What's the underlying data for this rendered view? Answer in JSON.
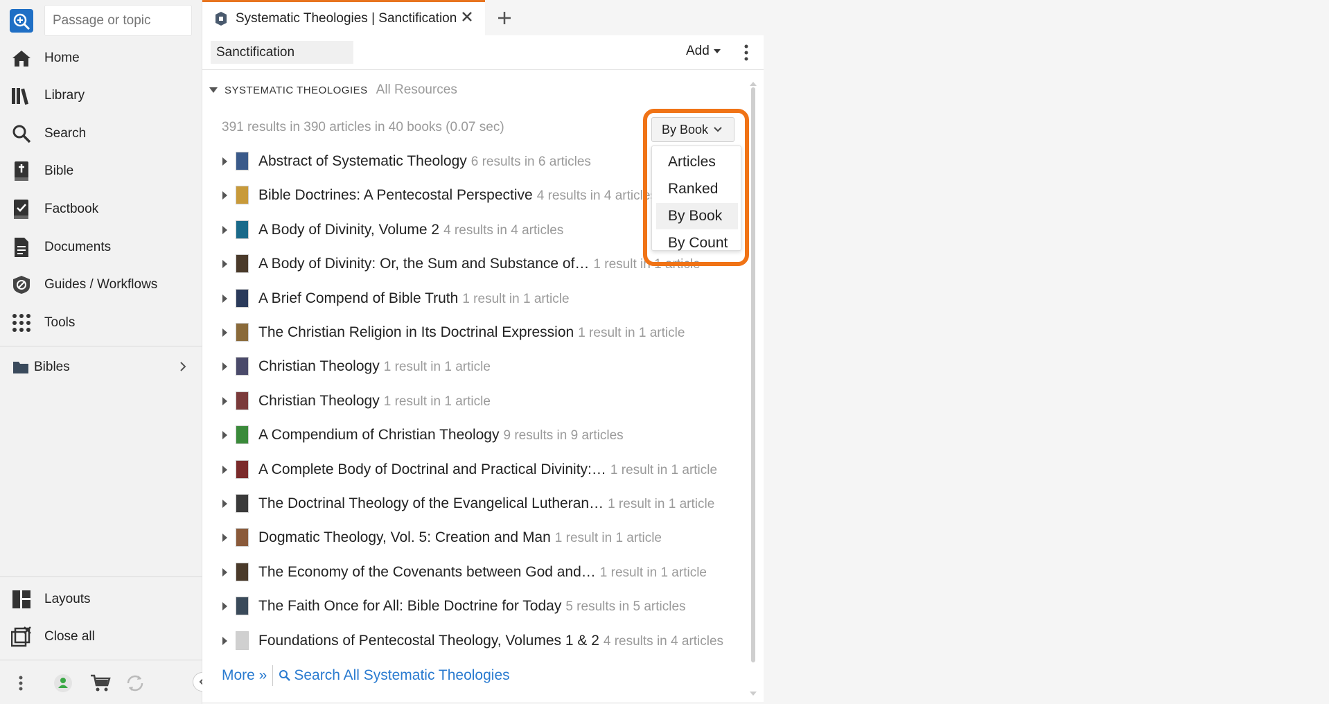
{
  "search": {
    "placeholder": "Passage or topic"
  },
  "sidebar": {
    "items": [
      {
        "label": "Home",
        "icon": "home-icon"
      },
      {
        "label": "Library",
        "icon": "library-icon"
      },
      {
        "label": "Search",
        "icon": "search-icon"
      },
      {
        "label": "Bible",
        "icon": "bible-icon"
      },
      {
        "label": "Factbook",
        "icon": "factbook-icon"
      },
      {
        "label": "Documents",
        "icon": "documents-icon"
      },
      {
        "label": "Guides / Workflows",
        "icon": "guides-icon"
      },
      {
        "label": "Tools",
        "icon": "tools-icon"
      }
    ],
    "bibles_label": "Bibles",
    "bottom_items": [
      {
        "label": "Layouts",
        "icon": "layouts-icon"
      },
      {
        "label": "Close all",
        "icon": "close-all-icon"
      }
    ]
  },
  "tab": {
    "title": "Systematic Theologies | Sanctification"
  },
  "toolbar": {
    "query": "Sanctification",
    "add_label": "Add"
  },
  "group": {
    "title": "SYSTEMATIC THEOLOGIES",
    "subtitle": "All Resources"
  },
  "summary": "391 results in 390 articles in 40 books (0.07 sec)",
  "sort": {
    "current": "By Book",
    "options": [
      "Articles",
      "Ranked",
      "By Book",
      "By Count"
    ]
  },
  "results": [
    {
      "title": "Abstract of Systematic Theology",
      "count": "6 results in 6 articles"
    },
    {
      "title": "Bible Doctrines: A Pentecostal Perspective",
      "count": "4 results in 4 articles"
    },
    {
      "title": "A Body of Divinity, Volume 2",
      "count": "4 results in 4 articles"
    },
    {
      "title": "A Body of Divinity: Or, the Sum and Substance of…",
      "count": "1 result in 1 article"
    },
    {
      "title": "A Brief Compend of Bible Truth",
      "count": "1 result in 1 article"
    },
    {
      "title": "The Christian Religion in Its Doctrinal Expression",
      "count": "1 result in 1 article"
    },
    {
      "title": "Christian Theology",
      "count": "1 result in 1 article"
    },
    {
      "title": "Christian Theology",
      "count": "1 result in 1 article"
    },
    {
      "title": "A Compendium of Christian Theology",
      "count": "9 results in 9 articles"
    },
    {
      "title": "A Complete Body of Doctrinal and Practical Divinity:…",
      "count": "1 result in 1 article"
    },
    {
      "title": "The Doctrinal Theology of the Evangelical Lutheran…",
      "count": "1 result in 1 article"
    },
    {
      "title": "Dogmatic Theology, Vol. 5: Creation and Man",
      "count": "1 result in 1 article"
    },
    {
      "title": "The Economy of the Covenants between God and…",
      "count": "1 result in 1 article"
    },
    {
      "title": "The Faith Once for All: Bible Doctrine for Today",
      "count": "5 results in 5 articles"
    },
    {
      "title": "Foundations of Pentecostal Theology, Volumes 1 & 2",
      "count": "4 results in 4 articles"
    }
  ],
  "footer": {
    "more": "More »",
    "search_all": "Search All Systematic Theologies"
  },
  "colors": {
    "accent": "#e8741f",
    "link": "#2a7bd0",
    "highlight": "#f07316"
  }
}
